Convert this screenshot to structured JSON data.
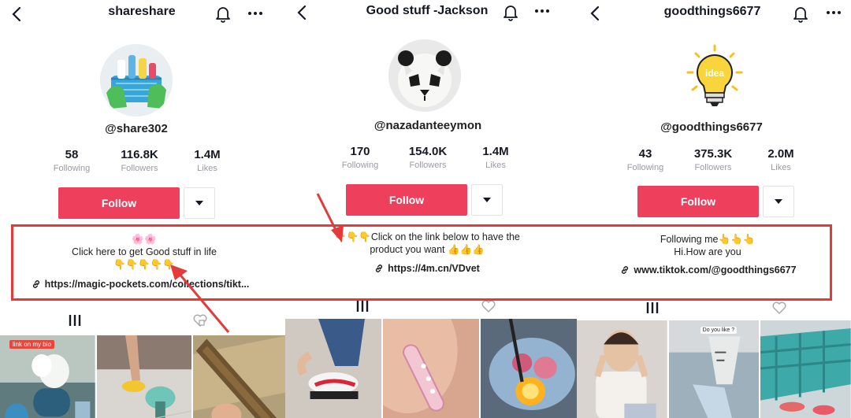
{
  "panels": [
    {
      "title": "shareshare",
      "handle": "@share302",
      "stats": [
        {
          "value": "58",
          "label": "Following"
        },
        {
          "value": "116.8K",
          "label": "Followers"
        },
        {
          "value": "1.4M",
          "label": "Likes"
        }
      ],
      "follow_label": "Follow",
      "bio_lines": [
        "🌸🌸",
        "Click here to get Good stuff in life",
        "👇👇👇👇👇"
      ],
      "link": "https://magic-pockets.com/collections/tikt...",
      "video_tag": "link on my bio"
    },
    {
      "title": "Good stuff -Jackson",
      "handle": "@nazadanteeymon",
      "stats": [
        {
          "value": "170",
          "label": "Following"
        },
        {
          "value": "154.0K",
          "label": "Followers"
        },
        {
          "value": "1.4M",
          "label": "Likes"
        }
      ],
      "follow_label": "Follow",
      "bio_lines": [
        "👇👇👇Click on the link below to have the",
        "product you want 👍👍👍"
      ],
      "link": "https://4m.cn/VDvet"
    },
    {
      "title": "goodthings6677",
      "handle": "@goodthings6677",
      "stats": [
        {
          "value": "43",
          "label": "Following"
        },
        {
          "value": "375.3K",
          "label": "Followers"
        },
        {
          "value": "2.0M",
          "label": "Likes"
        }
      ],
      "follow_label": "Follow",
      "bio_lines": [
        "Following me👆👆👆",
        "Hi.How are you"
      ],
      "link": "www.tiktok.com/@goodthings6677",
      "avatar_text": "idea",
      "video_tag": "Do you like ?"
    }
  ],
  "colors": {
    "follow": "#ee3f5c",
    "annotation": "#e43a3a"
  }
}
